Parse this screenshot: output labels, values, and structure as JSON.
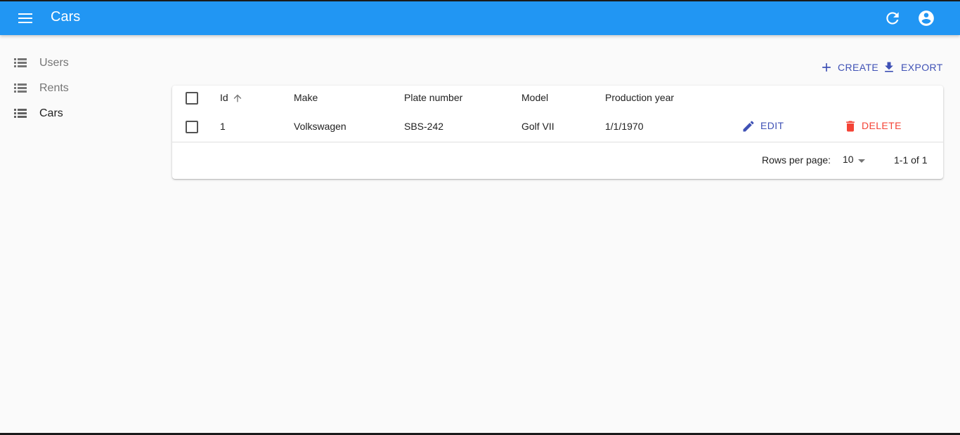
{
  "appbar": {
    "title": "Cars",
    "menu_icon": "menu-icon",
    "refresh_icon": "refresh-icon",
    "account_icon": "account-circle-icon",
    "color": "#2196f3"
  },
  "sidebar": {
    "items": [
      {
        "label": "Users",
        "icon": "list-icon",
        "active": false
      },
      {
        "label": "Rents",
        "icon": "list-icon",
        "active": false
      },
      {
        "label": "Cars",
        "icon": "list-icon",
        "active": true
      }
    ]
  },
  "actions": {
    "create_label": "CREATE",
    "export_label": "EXPORT",
    "create_icon": "add-icon",
    "export_icon": "download-icon",
    "accent": "#3f51b5"
  },
  "table": {
    "columns": [
      "Id",
      "Make",
      "Plate number",
      "Model",
      "Production year"
    ],
    "sort": {
      "column": "Id",
      "direction": "asc"
    },
    "rows": [
      {
        "id": "1",
        "make": "Volkswagen",
        "plate": "SBS-242",
        "model": "Golf VII",
        "year": "1/1/1970"
      }
    ],
    "edit_label": "EDIT",
    "delete_label": "DELETE",
    "delete_color": "#f44336"
  },
  "pagination": {
    "rows_per_page_label": "Rows per page:",
    "rows_per_page": "10",
    "range": "1-1 of 1"
  }
}
